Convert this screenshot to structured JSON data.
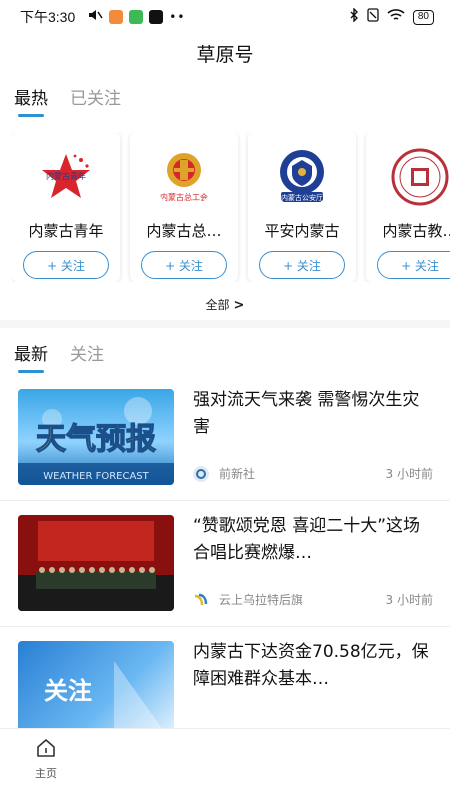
{
  "status_bar": {
    "time": "下午3:30",
    "battery": "80"
  },
  "header": {
    "title": "草原号"
  },
  "top_tabs": [
    {
      "label": "最热",
      "active": true
    },
    {
      "label": "已关注",
      "active": false
    }
  ],
  "accounts": [
    {
      "name": "内蒙古青年",
      "logo_text": "内蒙古青年",
      "follow_label": "+ 关注"
    },
    {
      "name": "内蒙古总…",
      "logo_text": "内蒙古总工会",
      "follow_label": "+ 关注"
    },
    {
      "name": "平安内蒙古",
      "logo_text": "内蒙古公安厅",
      "follow_label": "+ 关注"
    },
    {
      "name": "内蒙古教…",
      "logo_text": "",
      "follow_label": "+ 关注"
    }
  ],
  "all_link": {
    "label": "全部",
    "chevron": ">"
  },
  "news_tabs": [
    {
      "label": "最新",
      "active": true
    },
    {
      "label": "关注",
      "active": false
    }
  ],
  "news": [
    {
      "title": "强对流天气来袭 需警惕次生灾害",
      "thumb_text": "天气预报",
      "thumb_sub": "WEATHER FORECAST",
      "source": "前新社",
      "time": "3 小时前"
    },
    {
      "title": "“赞歌颂党恩 喜迎二十大”这场合唱比赛燃爆…",
      "thumb_text": "",
      "source": "云上乌拉特后旗",
      "time": "3 小时前"
    },
    {
      "title": "内蒙古下达资金70.58亿元，保障困难群众基本…",
      "thumb_text": "关注",
      "source": "",
      "time": ""
    }
  ],
  "bottom_nav": {
    "home_label": "主页"
  },
  "colors": {
    "accent": "#2f8fd5",
    "follow_border": "#3a8fcf"
  }
}
